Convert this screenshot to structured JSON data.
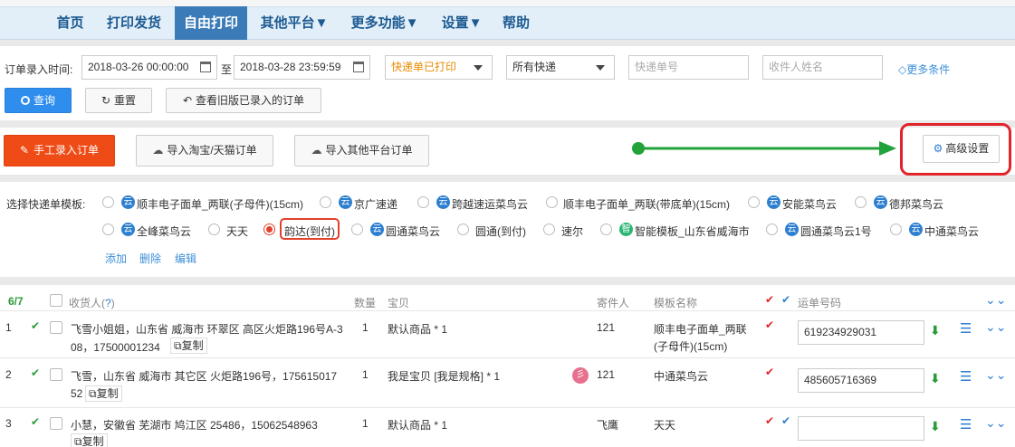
{
  "nav": {
    "items": [
      "首页",
      "打印发货",
      "自由打印",
      "其他平台▼",
      "更多功能▼",
      "设置▼",
      "帮助"
    ]
  },
  "filters": {
    "date_label": "订单录入时间:",
    "date_from": "2018-03-26 00:00:00",
    "date_to_label": "至",
    "date_to": "2018-03-28 23:59:59",
    "print_status": "快递单已打印",
    "courier": "所有快递",
    "tracking_placeholder": "快递单号",
    "recipient_placeholder": "收件人姓名",
    "more_conditions": "◇更多条件",
    "query_button": "查询",
    "reset_button": "重置",
    "old_orders_button": "查看旧版已录入的订单"
  },
  "actions": {
    "manual_entry": "手工录入订单",
    "import_taobao": "导入淘宝/天猫订单",
    "import_other": "导入其他平台订单",
    "advanced_settings": "高级设置"
  },
  "templates": {
    "label": "选择快递单模板:",
    "row1": [
      {
        "name": "顺丰电子面单_两联(子母件)(15cm)",
        "badge": "云"
      },
      {
        "name": "京广速递",
        "badge": "云"
      },
      {
        "name": "跨越速运菜鸟云",
        "badge": "云"
      },
      {
        "name": "顺丰电子面单_两联(带底单)(15cm)",
        "badge": ""
      },
      {
        "name": "安能菜鸟云",
        "badge": "云"
      },
      {
        "name": "德邦菜鸟云",
        "badge": "云"
      }
    ],
    "row2": [
      {
        "name": "全峰菜鸟云",
        "badge": "云"
      },
      {
        "name": "天天",
        "badge": ""
      },
      {
        "name": "韵达(到付)",
        "badge": "",
        "selected": true
      },
      {
        "name": "圆通菜鸟云",
        "badge": "云"
      },
      {
        "name": "圆通(到付)",
        "badge": ""
      },
      {
        "name": "速尔",
        "badge": ""
      },
      {
        "name": "智能模板_山东省威海市",
        "badge": "智"
      },
      {
        "name": "圆通菜鸟云1号",
        "badge": "云"
      },
      {
        "name": "中通菜鸟云",
        "badge": "云"
      }
    ],
    "add": "添加",
    "delete": "删除",
    "edit": "编辑"
  },
  "table": {
    "count": "6/7",
    "columns": {
      "recipient": "收货人(",
      "recipient_help": "?",
      "recipient_end": ")",
      "quantity": "数量",
      "item": "宝贝",
      "sender": "寄件人",
      "template": "模板名称",
      "tracking": "运单号码"
    },
    "copy_label": "复制",
    "rows": [
      {
        "num": "1",
        "addr1": "飞雪小姐姐，山东省 威海市 环翠区 高区火炬路196号A-3",
        "addr2": "08，17500001234",
        "qty": "1",
        "item": "默认商品 * 1",
        "sender": "121",
        "template1": "顺丰电子面单_两联",
        "template2": "(子母件)(15cm)",
        "tracking": "619234929031"
      },
      {
        "num": "2",
        "addr1": "飞雪，山东省 威海市 其它区 火炬路196号，175615017",
        "addr2": "52",
        "qty": "1",
        "item": "我是宝贝 [我是规格] * 1",
        "sender": "121",
        "template1": "中通菜鸟云",
        "template2": "",
        "tracking": "485605716369"
      },
      {
        "num": "3",
        "addr1": "小慧，安徽省 芜湖市 鸠江区 25486，15062548963",
        "addr2": "",
        "qty": "1",
        "item": "默认商品 * 1",
        "sender": "飞鹰",
        "template1": "天天",
        "template2": "",
        "tracking": ""
      }
    ]
  },
  "colors": {
    "nav_active": "#3b7cb8",
    "primary": "#2e8ded",
    "danger": "#ef4b16",
    "highlight_red": "#e2232a",
    "arrow_green": "#21a23a"
  }
}
